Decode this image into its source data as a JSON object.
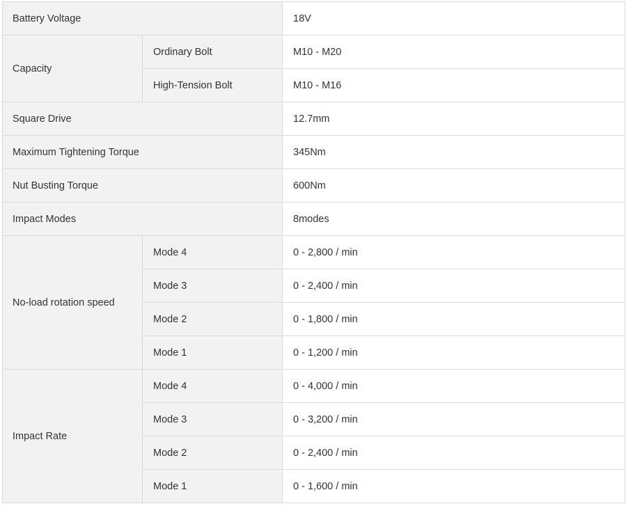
{
  "specs": {
    "battery_voltage": {
      "label": "Battery Voltage",
      "value": "18V"
    },
    "capacity": {
      "label": "Capacity",
      "rows": [
        {
          "sub": "Ordinary Bolt",
          "value": "M10 - M20"
        },
        {
          "sub": "High-Tension Bolt",
          "value": "M10 - M16"
        }
      ]
    },
    "square_drive": {
      "label": "Square Drive",
      "value": "12.7mm"
    },
    "max_tightening_torque": {
      "label": "Maximum Tightening Torque",
      "value": "345Nm"
    },
    "nut_busting_torque": {
      "label": "Nut Busting Torque",
      "value": "600Nm"
    },
    "impact_modes": {
      "label": "Impact Modes",
      "value": "8modes"
    },
    "no_load_rotation_speed": {
      "label": "No-load rotation speed",
      "rows": [
        {
          "sub": "Mode 4",
          "value": "0 - 2,800 / min"
        },
        {
          "sub": "Mode 3",
          "value": "0 - 2,400 / min"
        },
        {
          "sub": "Mode 2",
          "value": "0 - 1,800 / min"
        },
        {
          "sub": "Mode 1",
          "value": "0 - 1,200 / min"
        }
      ]
    },
    "impact_rate": {
      "label": "Impact Rate",
      "rows": [
        {
          "sub": "Mode 4",
          "value": "0 - 4,000 / min"
        },
        {
          "sub": "Mode 3",
          "value": "0 - 3,200 / min"
        },
        {
          "sub": "Mode 2",
          "value": "0 - 2,400 / min"
        },
        {
          "sub": "Mode 1",
          "value": "0 - 1,600 / min"
        }
      ]
    }
  }
}
